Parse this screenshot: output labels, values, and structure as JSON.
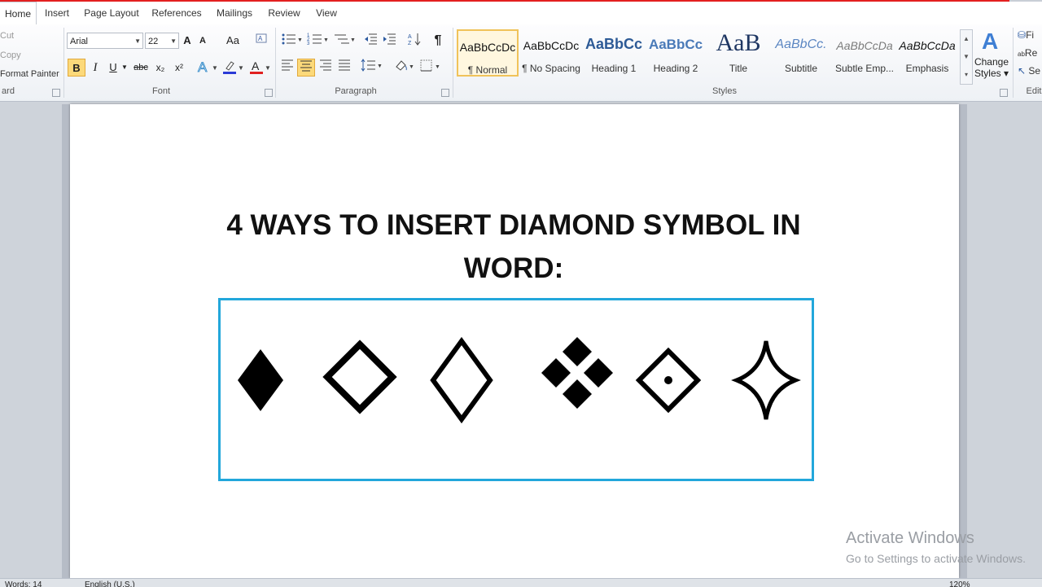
{
  "tabs": [
    "Home",
    "Insert",
    "Page Layout",
    "References",
    "Mailings",
    "Review",
    "View"
  ],
  "clipboard": {
    "cut": "Cut",
    "copy": "Copy",
    "format_painter": "Format Painter",
    "label": "ard"
  },
  "font": {
    "family": "Arial",
    "size": "22",
    "label": "Font",
    "grow": "A",
    "shrink": "A",
    "change_case": "Aa",
    "bold": "B",
    "italic": "I",
    "underline": "U",
    "strike": "abc",
    "subscript": "x₂",
    "superscript": "x²"
  },
  "paragraph": {
    "label": "Paragraph",
    "pilcrow": "¶"
  },
  "styles": {
    "label": "Styles",
    "items": [
      {
        "sample": "AaBbCcDc",
        "name": "¶ Normal"
      },
      {
        "sample": "AaBbCcDc",
        "name": "¶ No Spacing"
      },
      {
        "sample": "AaBbCc",
        "name": "Heading 1"
      },
      {
        "sample": "AaBbCc",
        "name": "Heading 2"
      },
      {
        "sample": "AaB",
        "name": "Title"
      },
      {
        "sample": "AaBbCc.",
        "name": "Subtitle"
      },
      {
        "sample": "AaBbCcDa",
        "name": "Subtle Emp..."
      },
      {
        "sample": "AaBbCcDa",
        "name": "Emphasis"
      }
    ],
    "change_styles_line1": "Change",
    "change_styles_line2": "Styles"
  },
  "editing": {
    "label": "Edit",
    "find": "Fi",
    "replace": "Re",
    "select": "Se"
  },
  "document": {
    "title": "4 WAYS TO INSERT DIAMOND SYMBOL IN WORD:"
  },
  "status": {
    "words": "Words: 14",
    "language": "English (U.S.)",
    "zoom": "120%"
  },
  "watermark": {
    "line1": "Activate Windows",
    "line2": "Go to Settings to activate Windows."
  },
  "colors": {
    "frame": "#22a7db",
    "tab_highlight": "#e32020",
    "selected_style": "#f0c35a"
  }
}
